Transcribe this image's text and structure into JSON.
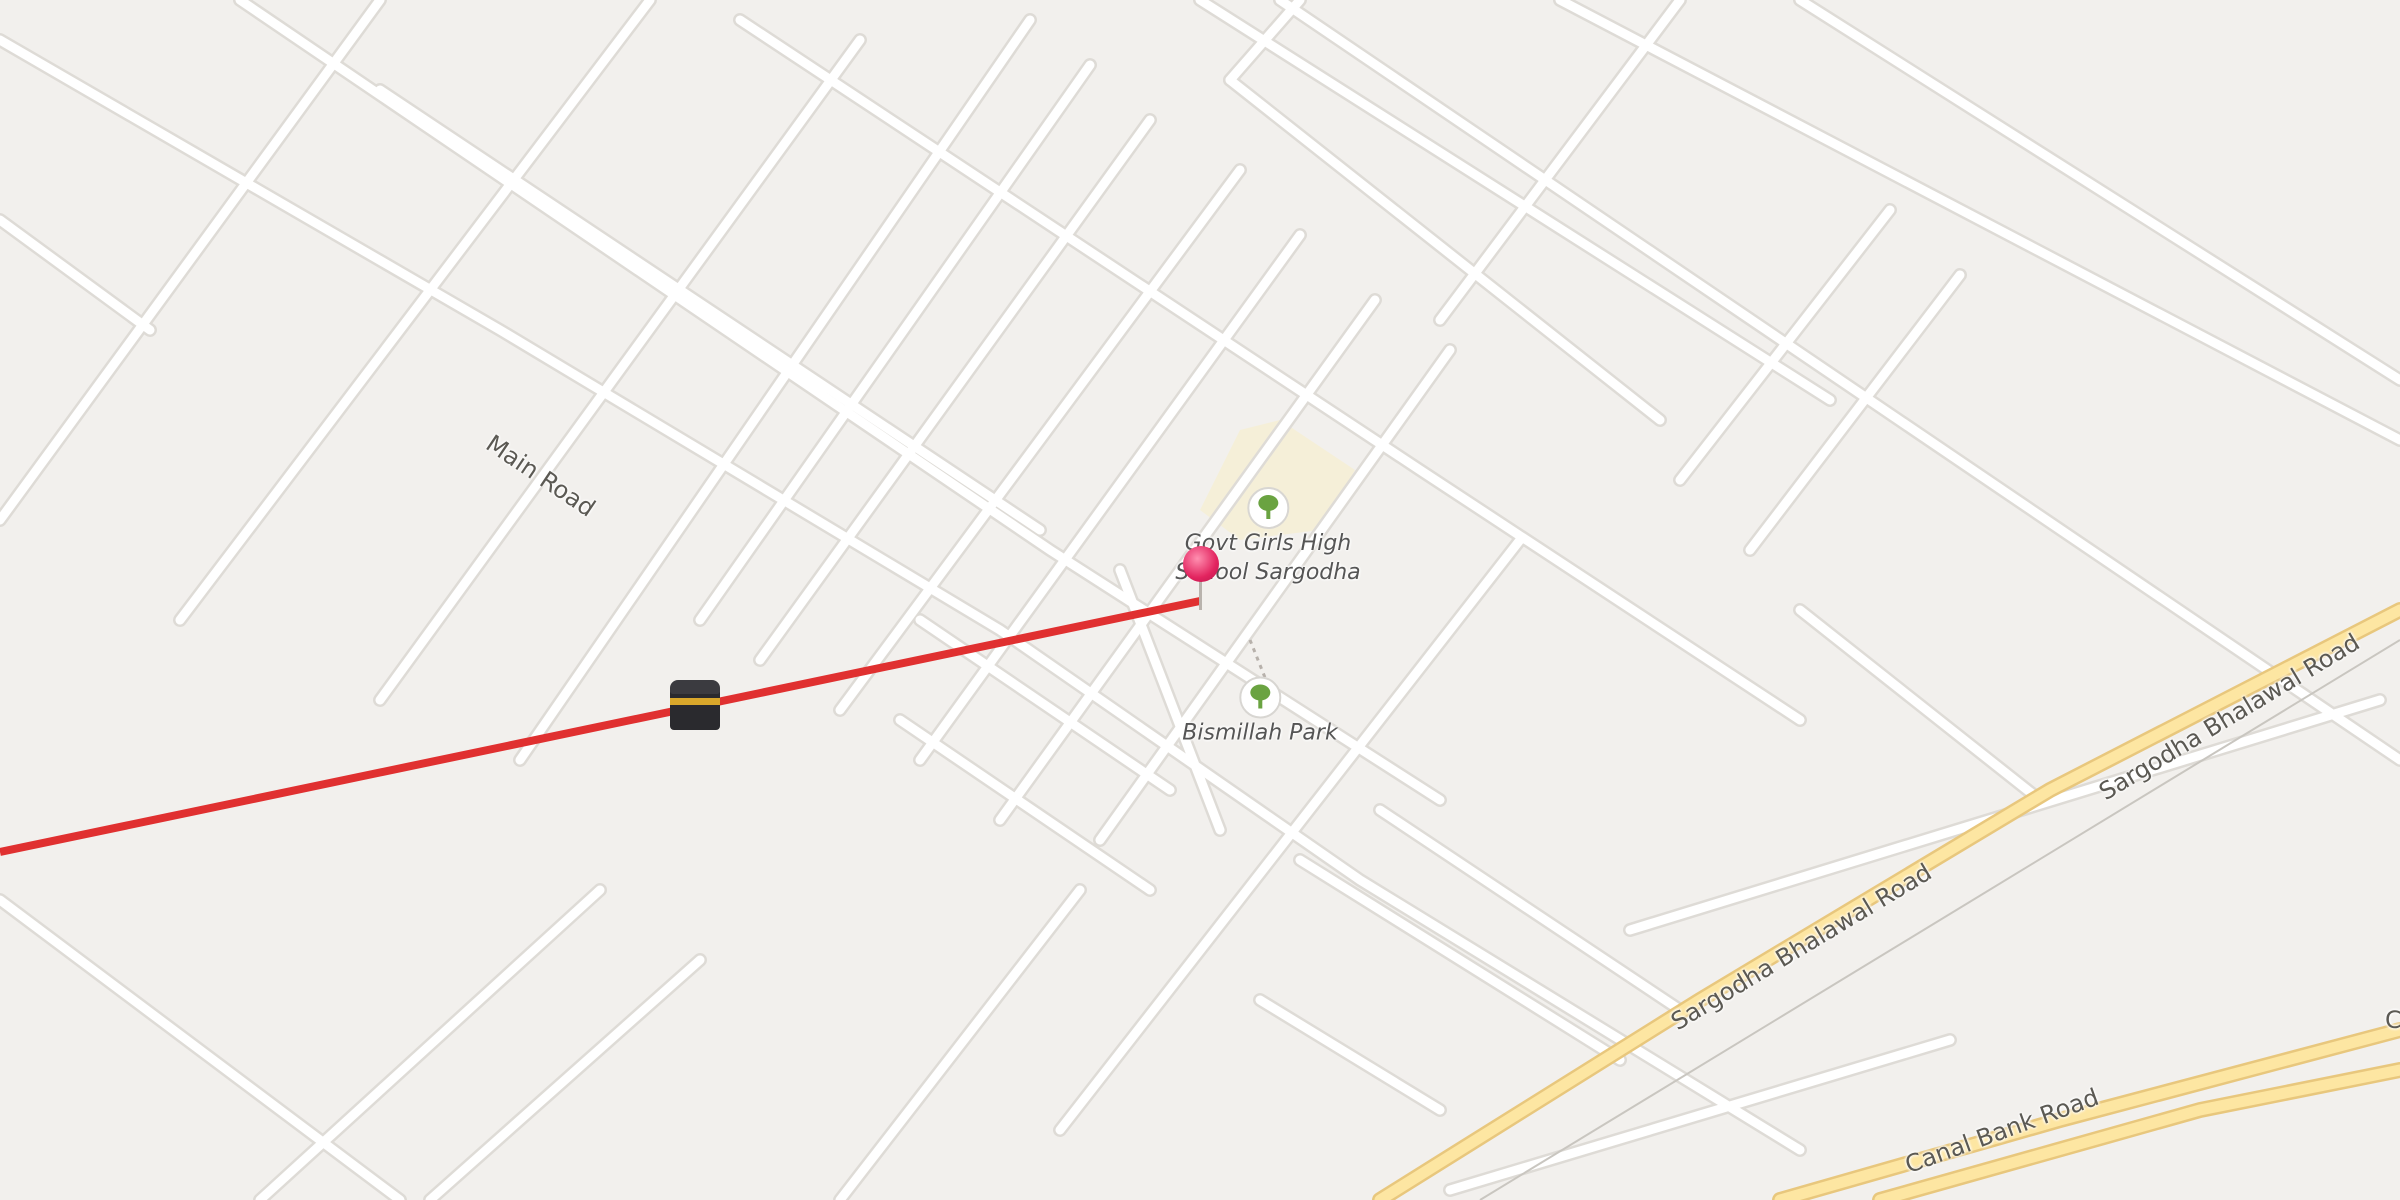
{
  "map": {
    "road_labels": {
      "main_road": "Main Road",
      "sargodha_bhalawal_1": "Sargodha Bhalawal Road",
      "sargodha_bhalawal_2": "Sargodha Bhalawal Road",
      "canal_bank_road": "Canal Bank Road",
      "edge_label": "C"
    },
    "pois": {
      "school": {
        "label_line1": "Govt Girls High",
        "label_line2": "School Sargodha",
        "icon": "tree-icon"
      },
      "park": {
        "label": "Bismillah Park",
        "icon": "tree-icon"
      }
    },
    "markers": {
      "location_pin": {
        "icon": "location-pin-icon",
        "color": "#e2245f"
      },
      "qibla": {
        "icon": "kaaba-icon"
      }
    },
    "colors": {
      "background": "#f2f0ed",
      "street": "#ffffff",
      "major_road": "#fde6a2",
      "qibla_line": "#e03030",
      "school_area": "#f5efd8"
    }
  }
}
